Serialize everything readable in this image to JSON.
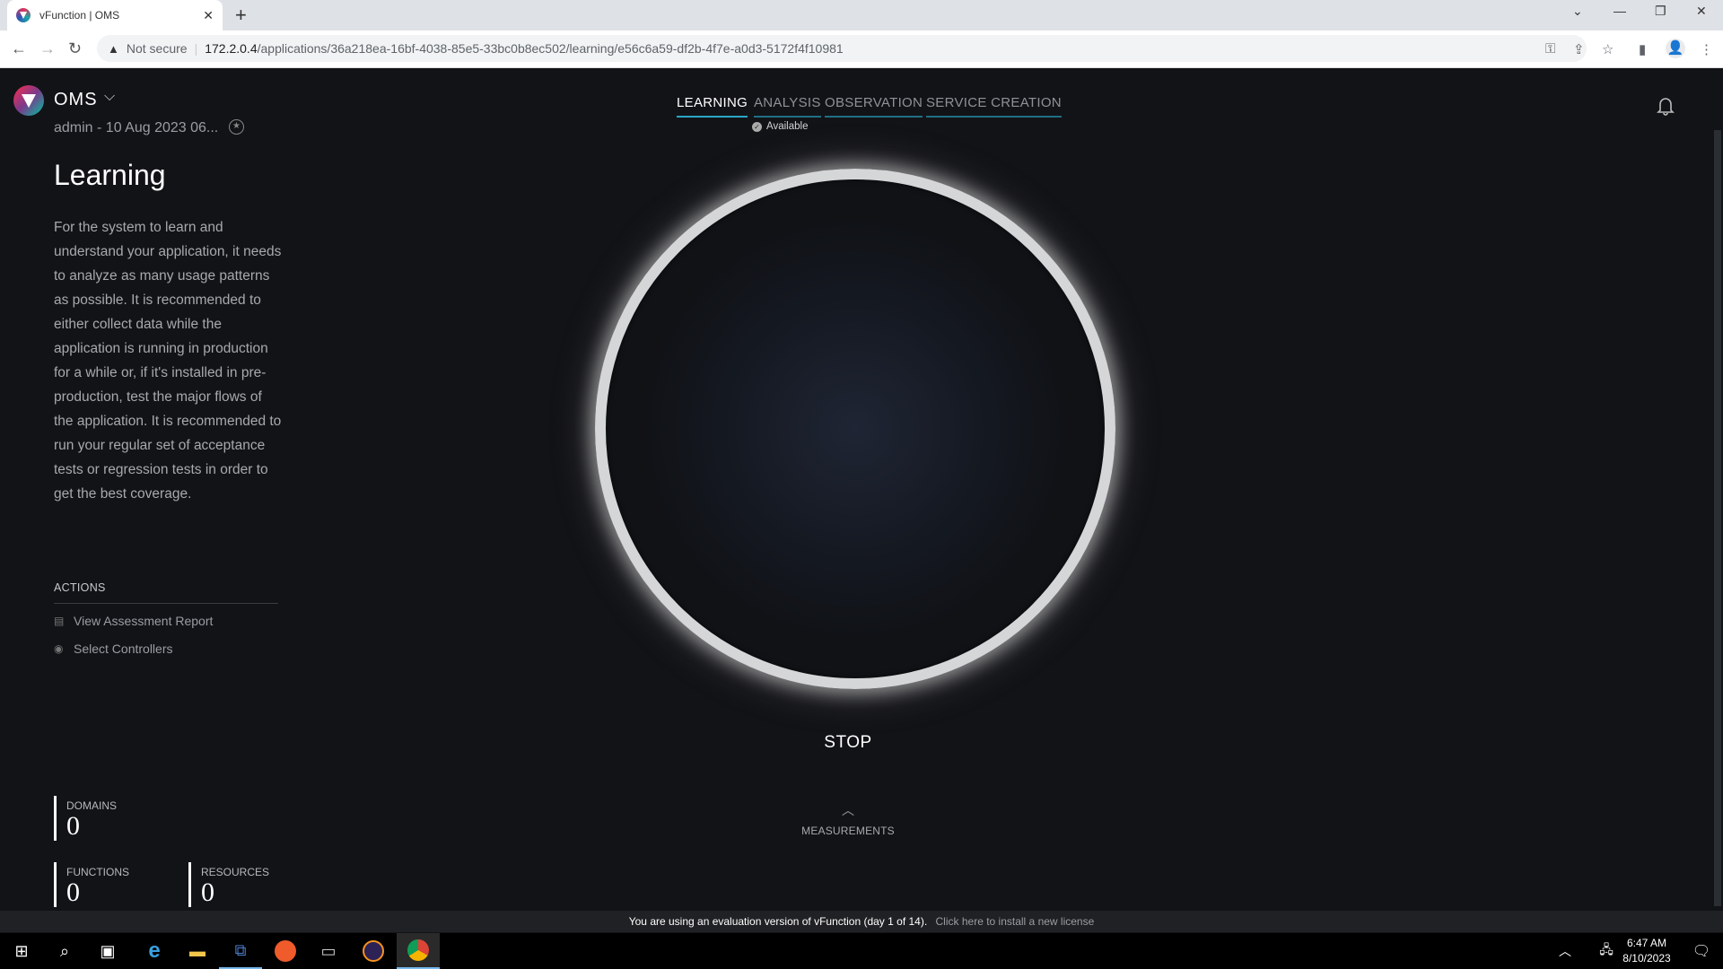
{
  "browser": {
    "tab_title": "vFunction | OMS",
    "security_label": "Not secure",
    "url_host": "172.2.0.4",
    "url_path": "/applications/36a218ea-16bf-4038-85e5-33bc0b8ec502/learning/e56c6a59-df2b-4f7e-a0d3-5172f4f10981"
  },
  "app": {
    "name": "OMS",
    "subtitle": "admin - 10 Aug 2023 06...",
    "page_title": "Learning",
    "description": "For the system to learn and understand your application, it needs to analyze as many usage patterns as possible. It is recommended to either collect data while the application is running in production for a while or, if it's installed in pre-production, test the major flows of the application. It is recommended to run your regular set of acceptance tests or regression tests in order to get the best coverage.",
    "actions_heading": "ACTIONS",
    "actions": [
      {
        "label": "View Assessment Report",
        "icon": "document-icon"
      },
      {
        "label": "Select Controllers",
        "icon": "radio-target-icon"
      }
    ],
    "stats": [
      {
        "label": "DOMAINS",
        "value": "0"
      },
      {
        "label": "FUNCTIONS",
        "value": "0"
      },
      {
        "label": "RESOURCES",
        "value": "0"
      }
    ]
  },
  "tabs": [
    {
      "label": "LEARNING",
      "active": true
    },
    {
      "label": "ANALYSIS",
      "active": false
    },
    {
      "label": "OBSERVATION",
      "active": false
    },
    {
      "label": "SERVICE CREATION",
      "active": false
    }
  ],
  "status": "Available",
  "main": {
    "stop_label": "STOP",
    "measurements_label": "MEASUREMENTS"
  },
  "banner": {
    "text": "You are using an evaluation version of vFunction (day 1 of 14).",
    "link": "Click here to install a new license"
  },
  "taskbar": {
    "time": "6:47 AM",
    "date": "8/10/2023"
  },
  "colors": {
    "accent": "#2aa6c6",
    "background": "#121317"
  }
}
